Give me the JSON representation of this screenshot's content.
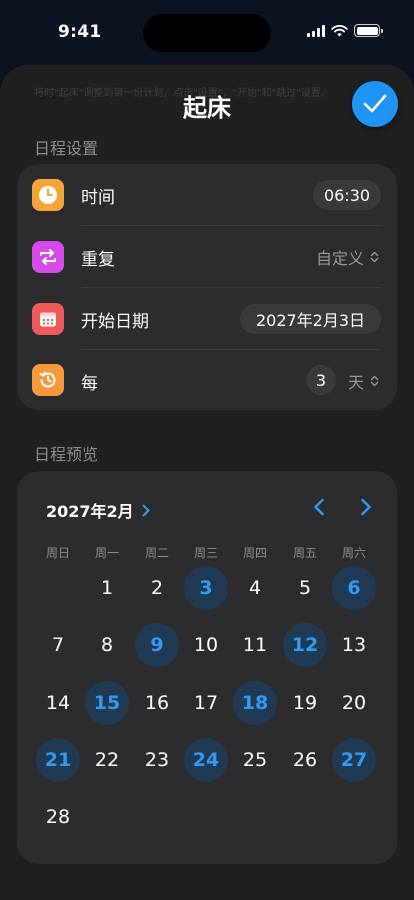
{
  "status_bar": {
    "time": "9:41"
  },
  "sheet": {
    "title": "起床",
    "ghost_text": "将时\"起床\"调整到第一份计划，点击\"设置\"，\"开始\"和\"跳过\"设置。"
  },
  "settings": {
    "header": "日程设置",
    "time_label": "时间",
    "time_value": "06:30",
    "repeat_label": "重复",
    "repeat_value": "自定义",
    "start_label": "开始日期",
    "start_value": "2027年2月3日",
    "every_label": "每",
    "every_value": "3",
    "every_unit": "天"
  },
  "preview": {
    "header": "日程预览",
    "month": "2027年2月",
    "weekdays": [
      "周日",
      "周一",
      "周二",
      "周三",
      "周四",
      "周五",
      "周六"
    ],
    "days": [
      "1",
      "2",
      "3",
      "4",
      "5",
      "6",
      "7",
      "8",
      "9",
      "10",
      "11",
      "12",
      "13",
      "14",
      "15",
      "16",
      "17",
      "18",
      "19",
      "20",
      "21",
      "22",
      "23",
      "24",
      "25",
      "26",
      "27",
      "28"
    ],
    "scheduled_days": [
      3,
      6,
      9,
      12,
      15,
      18,
      21,
      24,
      27
    ]
  },
  "colors": {
    "accent": "#1e95f4",
    "scheduled_bg": "#1f3a52",
    "scheduled_text": "#2f9bf5",
    "time_icon": "#f5a63a",
    "repeat_icon": "#d64be8",
    "date_icon": "#f05a5a",
    "every_icon": "#f59a3c"
  },
  "icons": {
    "time": "clock-icon",
    "repeat": "repeat-icon",
    "date": "calendar-icon",
    "every": "history-icon"
  }
}
